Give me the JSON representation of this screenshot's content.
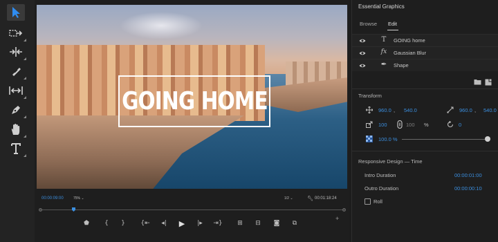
{
  "toolbar": {
    "tools": [
      {
        "name": "selection-tool",
        "icon": "arrow-cursor-icon",
        "active": true
      },
      {
        "name": "track-select-tool",
        "icon": "track-select-forward-icon"
      },
      {
        "name": "ripple-edit-tool",
        "icon": "ripple-edit-icon"
      },
      {
        "name": "razor-tool",
        "icon": "razor-icon"
      },
      {
        "name": "slip-tool",
        "icon": "slip-icon"
      },
      {
        "name": "pen-tool",
        "icon": "pen-icon"
      },
      {
        "name": "hand-tool",
        "icon": "hand-icon"
      },
      {
        "name": "type-tool",
        "icon": "type-icon",
        "label": "T"
      }
    ]
  },
  "monitor": {
    "title_overlay": "GOING HOME",
    "current_timecode": "00:00:09:00",
    "zoom": "75%",
    "resolution": "1/2",
    "duration_timecode": "00:01:18:24",
    "playhead_fraction": 0.11,
    "plus_label": "+",
    "transport": [
      {
        "name": "add-marker-button",
        "icon": "marker-icon",
        "glyph": "⬟"
      },
      {
        "name": "mark-in-button",
        "icon": "mark-in-icon",
        "glyph": "{"
      },
      {
        "name": "mark-out-button",
        "icon": "mark-out-icon",
        "glyph": "}"
      },
      {
        "name": "go-to-in-button",
        "icon": "go-to-in-icon",
        "glyph": "{⇤"
      },
      {
        "name": "step-back-button",
        "icon": "step-back-icon",
        "glyph": "◂|"
      },
      {
        "name": "play-button",
        "icon": "play-icon",
        "glyph": "▶"
      },
      {
        "name": "step-forward-button",
        "icon": "step-forward-icon",
        "glyph": "|▸"
      },
      {
        "name": "go-to-out-button",
        "icon": "go-to-out-icon",
        "glyph": "⇥}"
      },
      {
        "name": "lift-button",
        "icon": "lift-icon",
        "glyph": "⊞"
      },
      {
        "name": "extract-button",
        "icon": "extract-icon",
        "glyph": "⊟"
      },
      {
        "name": "export-frame-button",
        "icon": "camera-icon",
        "glyph": "◙"
      },
      {
        "name": "comparison-view-button",
        "icon": "comparison-view-icon",
        "glyph": "⧉"
      }
    ]
  },
  "panel": {
    "title": "Essential Graphics",
    "tabs": [
      {
        "label": "Browse",
        "active": false
      },
      {
        "label": "Edit",
        "active": true
      }
    ],
    "layers": [
      {
        "name": "GOING home",
        "icon": "text-layer-icon",
        "glyph": "T"
      },
      {
        "name": "Gaussian Blur",
        "icon": "fx-icon",
        "glyph": "fx"
      },
      {
        "name": "Shape",
        "icon": "pen-shape-icon",
        "glyph": "✒"
      }
    ],
    "transform": {
      "label": "Transform",
      "position": {
        "x": "960.0",
        "sep": ",",
        "y": "540.0"
      },
      "anchor": {
        "x": "960.0",
        "sep": ",",
        "y": "540.0"
      },
      "scale": {
        "w": "100",
        "h": "100",
        "unit": "%"
      },
      "rotation": "0",
      "opacity": "100.0 %"
    },
    "responsive": {
      "label": "Responsive Design — Time",
      "intro_label": "Intro Duration",
      "intro_value": "00:00:01:00",
      "outro_label": "Outro Duration",
      "outro_value": "00:00:00:10",
      "roll_label": "Roll",
      "roll_checked": false
    }
  },
  "colors": {
    "accent": "#3b8fe0",
    "panel_bg": "#1e1e1e",
    "text": "#c8c8c8"
  }
}
